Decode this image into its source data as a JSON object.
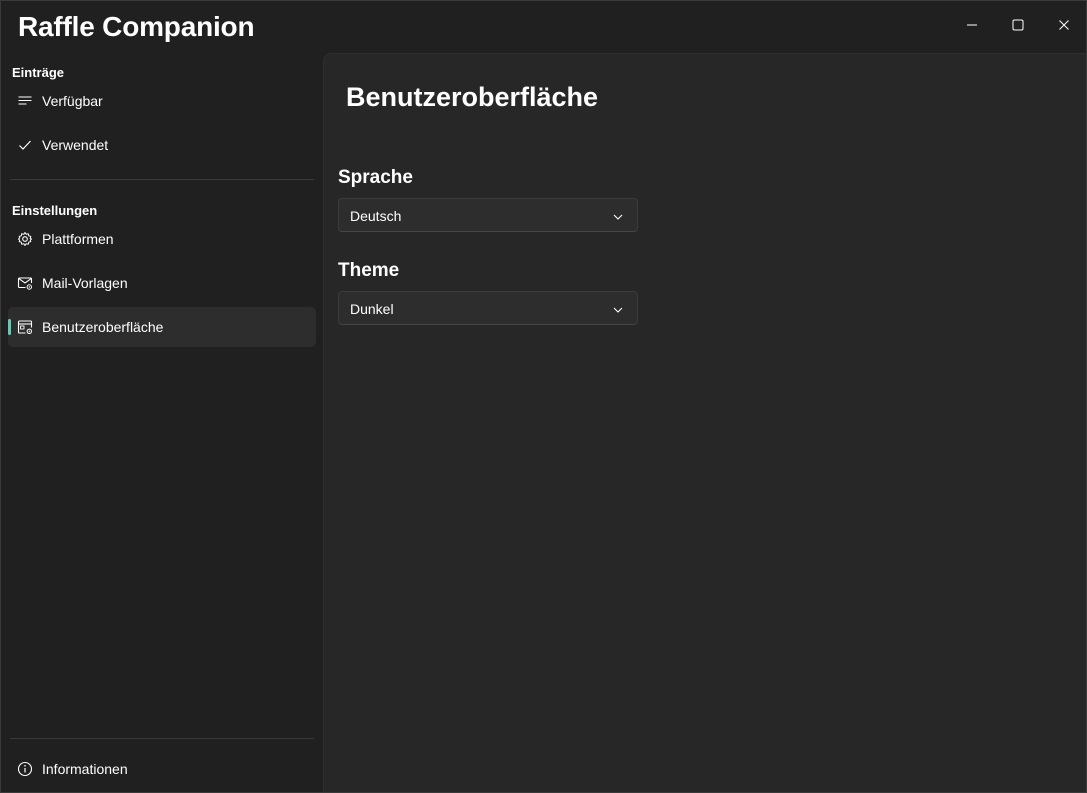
{
  "window": {
    "title": "Raffle Companion",
    "minimize_icon": "minimize-icon",
    "maximize_icon": "maximize-icon",
    "close_icon": "close-icon"
  },
  "sidebar": {
    "sections": [
      {
        "header": "Einträge",
        "items": [
          {
            "label": "Verfügbar",
            "icon": "list-icon"
          },
          {
            "label": "Verwendet",
            "icon": "checkmark-icon"
          }
        ]
      },
      {
        "header": "Einstellungen",
        "items": [
          {
            "label": "Plattformen",
            "icon": "gear-icon"
          },
          {
            "label": "Mail-Vorlagen",
            "icon": "mail-settings-icon"
          },
          {
            "label": "Benutzeroberfläche",
            "icon": "window-settings-icon",
            "selected": true
          }
        ]
      }
    ],
    "footer": {
      "label": "Informationen",
      "icon": "info-icon"
    }
  },
  "main": {
    "title": "Benutzeroberfläche",
    "fields": [
      {
        "label": "Sprache",
        "value": "Deutsch"
      },
      {
        "label": "Theme",
        "value": "Dunkel"
      }
    ]
  },
  "colors": {
    "accent": "#60cdb0",
    "background": "#202020",
    "content_background": "#272727",
    "selected_item": "#2d2d2d"
  }
}
